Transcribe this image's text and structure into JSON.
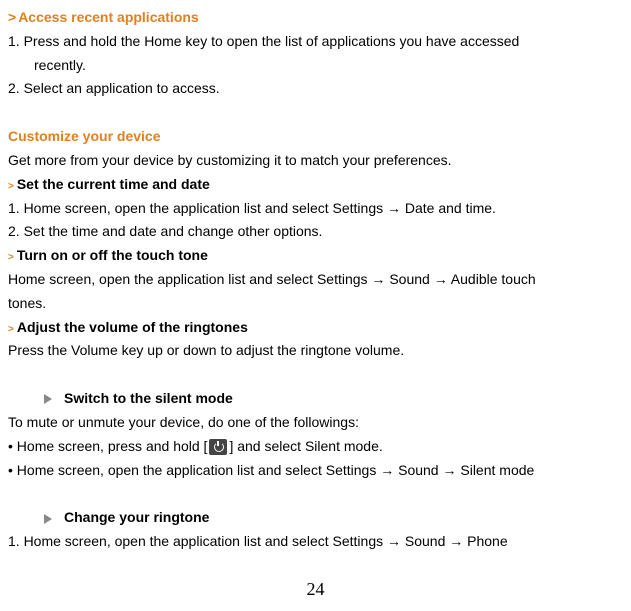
{
  "section1": {
    "heading": "Access recent applications",
    "step1_a": "1. Press and hold the Home key to open the list of applications you have accessed",
    "step1_b": "recently.",
    "step2": "2. Select an application to access."
  },
  "section2": {
    "heading": "Customize your device",
    "intro": "Get more from your device by customizing it to match your preferences."
  },
  "section3": {
    "heading": "Set the current time and date",
    "step1": "1. Home screen, open the application list and select Settings → Date and time.",
    "step2": "2. Set the time and date and change other options."
  },
  "section4": {
    "heading": "Turn on or off the touch tone",
    "body_a": "Home screen, open the application list and select Settings → Sound → Audible touch",
    "body_b": "tones."
  },
  "section5": {
    "heading": "Adjust the volume of the ringtones",
    "body": "Press the Volume key up or down to adjust the ringtone volume."
  },
  "section6": {
    "heading": "Switch to the silent mode",
    "intro": "To mute or unmute your device, do one of the followings:",
    "bullet1_a": "• Home screen, press and hold [",
    "bullet1_b": "] and select Silent mode.",
    "bullet2": "• Home screen, open the application list and select Settings → Sound → Silent mode"
  },
  "section7": {
    "heading": "Change your ringtone",
    "step1": "1.    Home screen, open the application list and select Settings  →  Sound  →  Phone"
  },
  "pageNumber": "24"
}
